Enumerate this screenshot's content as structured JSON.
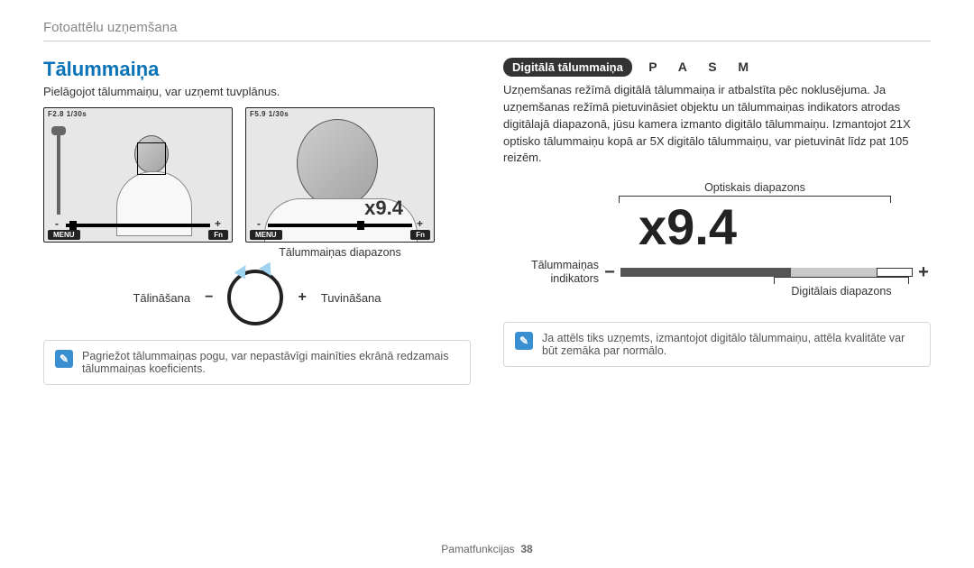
{
  "breadcrumb": "Fotoattēlu uzņemšana",
  "left": {
    "heading": "Tālummaiņa",
    "intro": "Pielāgojot tālummaiņu, var uzņemt tuvplānus.",
    "preview1": {
      "aperture": "F2.8 1/30s",
      "menu": "MENU",
      "fn": "Fn"
    },
    "preview2": {
      "aperture": "F5.9 1/30s",
      "menu": "MENU",
      "fn": "Fn",
      "zoom": "x9.4"
    },
    "range_label": "Tālummaiņas diapazons",
    "dial_out": "Tālināšana",
    "dial_in": "Tuvināšana",
    "note": "Pagriežot tālummaiņas pogu, var nepastāvīgi mainīties ekrānā redzamais tālummaiņas koeficients."
  },
  "right": {
    "pill": "Digitālā tālummaiņa",
    "modes": "P A S M",
    "body": "Uzņemšanas režīmā digitālā tālummaiņa ir atbalstīta pēc noklusējuma. Ja uzņemšanas režīmā pietuvināsiet objektu un tālummaiņas indikators atrodas digitālajā diapazonā, jūsu kamera izmanto digitālo tālummaiņu. Izmantojot 21X optisko tālummaiņu kopā ar 5X digitālo tālummaiņu, var pietuvināt līdz pat 105 reizēm.",
    "optical_label": "Optiskais diapazons",
    "bigzoom": "x9.4",
    "indicator_label": "Tālummaiņas indikators",
    "digital_label": "Digitālais diapazons",
    "note": "Ja attēls tiks uzņemts, izmantojot digitālo tālummaiņu, attēla kvalitāte var būt zemāka par normālo."
  },
  "footer": {
    "section": "Pamatfunkcijas",
    "page": "38"
  }
}
